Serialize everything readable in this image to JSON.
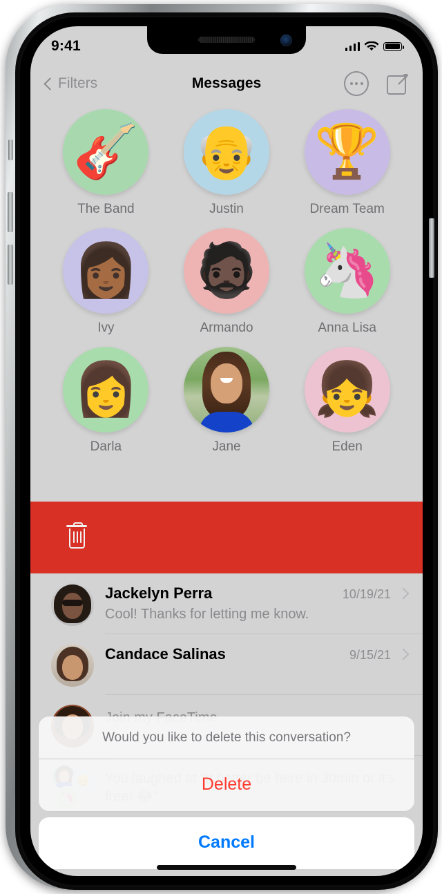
{
  "status_bar": {
    "time": "9:41",
    "cellular_icon": "cellular-bars-icon",
    "wifi_icon": "wifi-icon",
    "battery_icon": "battery-full-icon"
  },
  "nav_bar": {
    "back_label": "Filters",
    "back_icon": "chevron-left-icon",
    "title": "Messages",
    "more_icon": "more-circle-icon",
    "compose_icon": "compose-icon"
  },
  "pinned": [
    {
      "name": "The Band",
      "emoji": "🎸",
      "bg": "#a8d9ae",
      "kind": "emoji"
    },
    {
      "name": "Justin",
      "emoji": "👴",
      "bg": "#b4d7e7",
      "kind": "memoji"
    },
    {
      "name": "Dream Team",
      "emoji": "🏆",
      "bg": "#c8bce6",
      "kind": "emoji"
    },
    {
      "name": "Ivy",
      "emoji": "👩🏾",
      "bg": "#c6c2e8",
      "kind": "memoji"
    },
    {
      "name": "Armando",
      "emoji": "🧔🏿",
      "bg": "#eeb4b4",
      "kind": "memoji"
    },
    {
      "name": "Anna Lisa",
      "emoji": "🦄",
      "bg": "#a9dcad",
      "kind": "memoji"
    },
    {
      "name": "Darla",
      "emoji": "👩",
      "bg": "#a9dcad",
      "kind": "memoji"
    },
    {
      "name": "Jane",
      "emoji": "",
      "bg": "#cfd6d9",
      "kind": "photo"
    },
    {
      "name": "Eden",
      "emoji": "👧",
      "bg": "#edc3d2",
      "kind": "memoji"
    }
  ],
  "swipe_action": {
    "icon": "trash-icon",
    "color": "#d93025"
  },
  "conversations": [
    {
      "name": "Jackelyn Perra",
      "date": "10/19/21",
      "preview": "Cool! Thanks for letting me know.",
      "avatar": "photo-avatar-jackelyn"
    },
    {
      "name": "Candace Salinas",
      "date": "9/15/21",
      "preview": "",
      "avatar": "photo-avatar-candace"
    },
    {
      "name": "",
      "date": "",
      "preview": "Join my FaceTime",
      "avatar": "photo-avatar-facetime"
    },
    {
      "name": "",
      "date": "",
      "preview": "You laughed at “It better be here in 30min or it’s free! 😂”",
      "avatar": "group-avatar"
    }
  ],
  "action_sheet": {
    "message": "Would you like to delete this conversation?",
    "delete_label": "Delete",
    "cancel_label": "Cancel",
    "delete_color": "#ff3b30",
    "cancel_color": "#007aff"
  }
}
